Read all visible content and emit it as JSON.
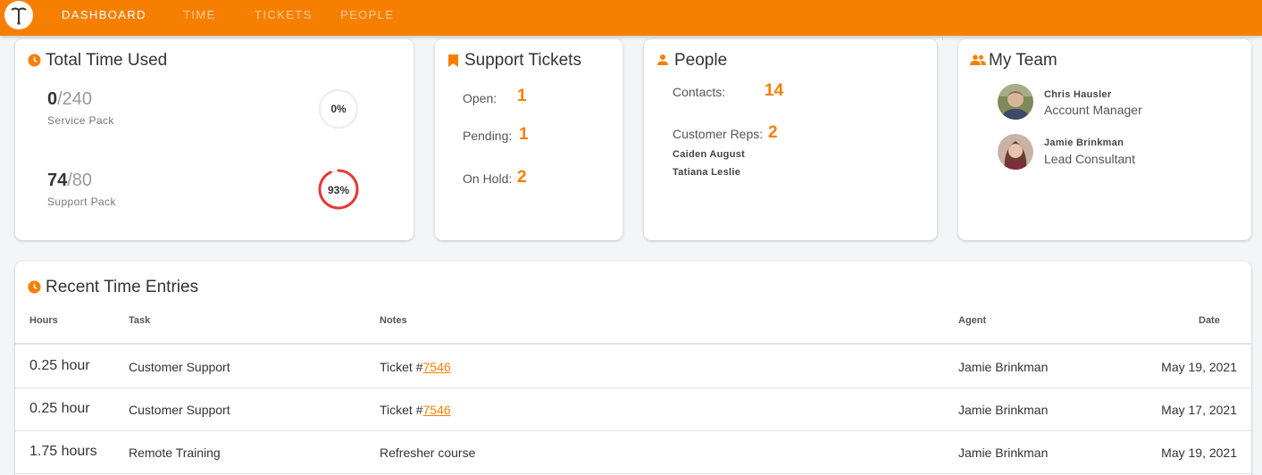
{
  "colors": {
    "accent": "#f77f00",
    "ring_danger": "#e53935",
    "ring_track": "#eeeeee"
  },
  "nav": [
    {
      "label": "DASHBOARD",
      "active": true
    },
    {
      "label": "TIME",
      "active": false
    },
    {
      "label": "TICKETS",
      "active": false
    },
    {
      "label": "PEOPLE",
      "active": false
    }
  ],
  "time_card": {
    "title": "Total Time Used",
    "icon": "clock-icon",
    "service": {
      "used": "0",
      "total": "/240",
      "label": "Service Pack",
      "percent_label": "0%",
      "fraction": 0
    },
    "support": {
      "used": "74",
      "total": "/80",
      "label": "Support Pack",
      "percent_label": "93%",
      "fraction": 0.93
    }
  },
  "tickets_card": {
    "title": "Support Tickets",
    "icon": "bookmark-icon",
    "open_label": "Open:",
    "open_value": "1",
    "pending_label": "Pending:",
    "pending_value": "1",
    "hold_label": "On Hold:",
    "hold_value": "2"
  },
  "people_card": {
    "title": "People",
    "icon": "person-icon",
    "contacts_label": "Contacts:",
    "contacts_value": "14",
    "reps_label": "Customer Reps:",
    "reps_value": "2",
    "reps": [
      "Caiden August",
      "Tatiana Leslie"
    ]
  },
  "team_card": {
    "title": "My Team",
    "icon": "group-icon",
    "members": [
      {
        "name": "Chris Hausler",
        "role": "Account Manager"
      },
      {
        "name": "Jamie Brinkman",
        "role": "Lead Consultant"
      }
    ]
  },
  "entries": {
    "title": "Recent Time Entries",
    "icon": "clock-icon",
    "columns": {
      "hours": "Hours",
      "task": "Task",
      "notes": "Notes",
      "agent": "Agent",
      "date": "Date"
    },
    "rows": [
      {
        "hours": "0.25 hour",
        "task": "Customer Support",
        "notes_prefix": "Ticket #",
        "notes_link": "7546",
        "agent": "Jamie Brinkman",
        "date": "May 19, 2021"
      },
      {
        "hours": "0.25 hour",
        "task": "Customer Support",
        "notes_prefix": "Ticket #",
        "notes_link": "7546",
        "agent": "Jamie Brinkman",
        "date": "May 17, 2021"
      },
      {
        "hours": "1.75 hours",
        "task": "Remote Training",
        "notes_prefix": "Refresher course",
        "notes_link": "",
        "agent": "Jamie Brinkman",
        "date": "May 19, 2021"
      }
    ]
  }
}
